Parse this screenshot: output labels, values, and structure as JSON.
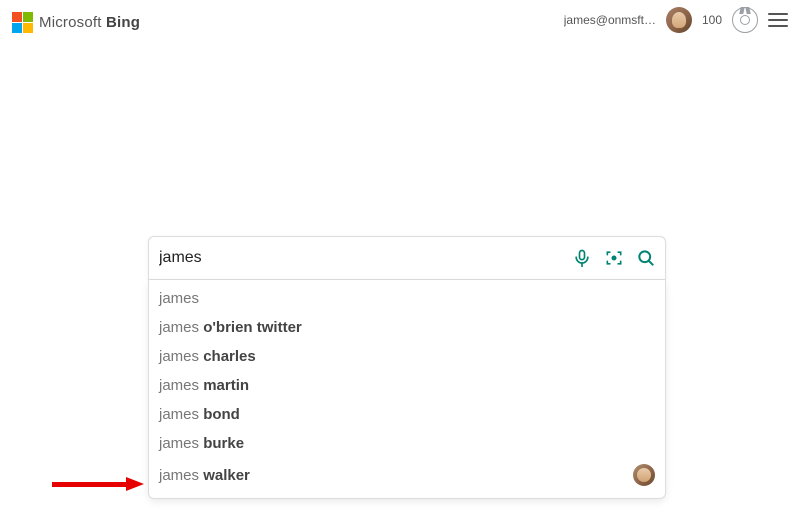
{
  "header": {
    "brand_prefix": "Microsoft ",
    "brand_name": "Bing",
    "user_email": "james@onmsft…",
    "points": "100"
  },
  "search": {
    "value": "james"
  },
  "suggestions": [
    {
      "match": "james",
      "rest": ""
    },
    {
      "match": "james ",
      "rest": "o'brien twitter"
    },
    {
      "match": "james ",
      "rest": "charles"
    },
    {
      "match": "james ",
      "rest": "martin"
    },
    {
      "match": "james ",
      "rest": "bond"
    },
    {
      "match": "james ",
      "rest": "burke"
    },
    {
      "match": "james ",
      "rest": "walker"
    }
  ],
  "colors": {
    "teal": "#008373",
    "arrow": "#e60000"
  }
}
